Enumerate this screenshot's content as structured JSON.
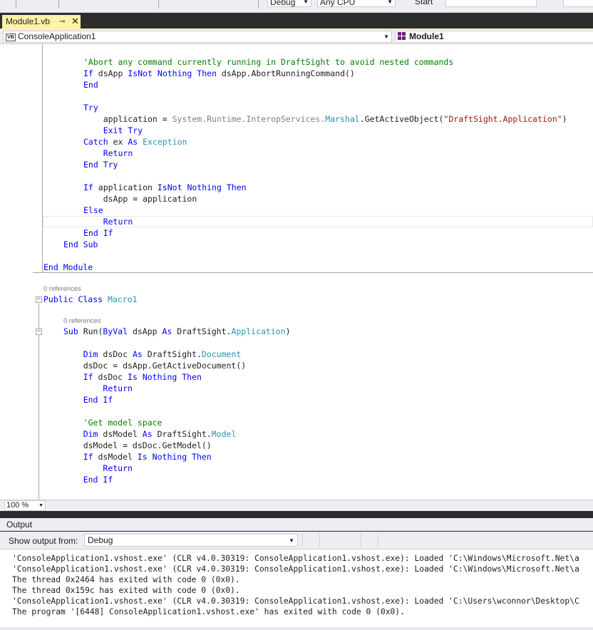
{
  "toolbar": {
    "config": "Debug",
    "platform": "Any CPU",
    "start_label": "Start"
  },
  "document_tab": {
    "label": "Module1.vb",
    "pin_glyph": "⊸",
    "close_glyph": "✕"
  },
  "navbar": {
    "project_icon": "VB",
    "project": "ConsoleApplication1",
    "member": "Module1"
  },
  "code_lines": [
    [
      {
        "t": "'Abort any command currently running in DraftSight to avoid nested commands",
        "c": "cm"
      }
    ],
    [
      {
        "t": "If",
        "c": "kw"
      },
      {
        "t": " dsApp "
      },
      {
        "t": "IsNot",
        "c": "kw"
      },
      {
        "t": " "
      },
      {
        "t": "Nothing",
        "c": "kw"
      },
      {
        "t": " "
      },
      {
        "t": "Then",
        "c": "kw"
      },
      {
        "t": " dsApp.AbortRunningCommand()"
      }
    ],
    [
      {
        "t": "End",
        "c": "kw"
      }
    ],
    [],
    [
      {
        "t": "Try",
        "c": "kw"
      }
    ],
    [
      {
        "t": "    application = "
      },
      {
        "t": "System.Runtime.InteropServices.",
        "c": "gr"
      },
      {
        "t": "Marshal",
        "c": "ty"
      },
      {
        "t": ".GetActiveObject("
      },
      {
        "t": "\"DraftSight.Application\"",
        "c": "st"
      },
      {
        "t": ")"
      }
    ],
    [
      {
        "t": "    "
      },
      {
        "t": "Exit Try",
        "c": "kw"
      }
    ],
    [
      {
        "t": "Catch",
        "c": "kw"
      },
      {
        "t": " ex "
      },
      {
        "t": "As",
        "c": "kw"
      },
      {
        "t": " "
      },
      {
        "t": "Exception",
        "c": "ty"
      }
    ],
    [
      {
        "t": "    "
      },
      {
        "t": "Return",
        "c": "kw"
      }
    ],
    [
      {
        "t": "End Try",
        "c": "kw"
      }
    ],
    [],
    [
      {
        "t": "If",
        "c": "kw"
      },
      {
        "t": " application "
      },
      {
        "t": "IsNot",
        "c": "kw"
      },
      {
        "t": " "
      },
      {
        "t": "Nothing",
        "c": "kw"
      },
      {
        "t": " "
      },
      {
        "t": "Then",
        "c": "kw"
      }
    ],
    [
      {
        "t": "    dsApp = application"
      }
    ],
    [
      {
        "t": "Else",
        "c": "kw"
      }
    ],
    [
      {
        "t": "    "
      },
      {
        "t": "Return",
        "c": "kw"
      }
    ],
    [
      {
        "t": "End If",
        "c": "kw"
      }
    ],
    [
      {
        "t": "End Sub",
        "c": "kw"
      }
    ],
    [],
    [
      {
        "t": "End Module",
        "c": "kw"
      }
    ]
  ],
  "class_block": {
    "ref1": "0 references",
    "class_decl": [
      {
        "t": "Public Class",
        "c": "kw"
      },
      {
        "t": " "
      },
      {
        "t": "Macro1",
        "c": "ty"
      }
    ],
    "ref2": "0 references",
    "lines": [
      [
        {
          "t": "Sub",
          "c": "kw"
        },
        {
          "t": " Run("
        },
        {
          "t": "ByVal",
          "c": "kw"
        },
        {
          "t": " dsApp "
        },
        {
          "t": "As",
          "c": "kw"
        },
        {
          "t": " DraftSight."
        },
        {
          "t": "Application",
          "c": "ty"
        },
        {
          "t": ")"
        }
      ],
      [],
      [
        {
          "t": "    "
        },
        {
          "t": "Dim",
          "c": "kw"
        },
        {
          "t": " dsDoc "
        },
        {
          "t": "As",
          "c": "kw"
        },
        {
          "t": " DraftSight."
        },
        {
          "t": "Document",
          "c": "ty"
        }
      ],
      [
        {
          "t": "    dsDoc = dsApp.GetActiveDocument()"
        }
      ],
      [
        {
          "t": "    "
        },
        {
          "t": "If",
          "c": "kw"
        },
        {
          "t": " dsDoc "
        },
        {
          "t": "Is",
          "c": "kw"
        },
        {
          "t": " "
        },
        {
          "t": "Nothing",
          "c": "kw"
        },
        {
          "t": " "
        },
        {
          "t": "Then",
          "c": "kw"
        }
      ],
      [
        {
          "t": "        "
        },
        {
          "t": "Return",
          "c": "kw"
        }
      ],
      [
        {
          "t": "    "
        },
        {
          "t": "End If",
          "c": "kw"
        }
      ],
      [],
      [
        {
          "t": "    "
        },
        {
          "t": "'Get model space",
          "c": "cm"
        }
      ],
      [
        {
          "t": "    "
        },
        {
          "t": "Dim",
          "c": "kw"
        },
        {
          "t": " dsModel "
        },
        {
          "t": "As",
          "c": "kw"
        },
        {
          "t": " DraftSight."
        },
        {
          "t": "Model",
          "c": "ty"
        }
      ],
      [
        {
          "t": "    dsModel = dsDoc.GetModel()"
        }
      ],
      [
        {
          "t": "    "
        },
        {
          "t": "If",
          "c": "kw"
        },
        {
          "t": " dsModel "
        },
        {
          "t": "Is",
          "c": "kw"
        },
        {
          "t": " "
        },
        {
          "t": "Nothing",
          "c": "kw"
        },
        {
          "t": " "
        },
        {
          "t": "Then",
          "c": "kw"
        }
      ],
      [
        {
          "t": "        "
        },
        {
          "t": "Return",
          "c": "kw"
        }
      ],
      [
        {
          "t": "    "
        },
        {
          "t": "End If",
          "c": "kw"
        }
      ]
    ]
  },
  "zoom": "100 %",
  "output": {
    "title": "Output",
    "show_from_label": "Show output from:",
    "source": "Debug",
    "lines": [
      "'ConsoleApplication1.vshost.exe' (CLR v4.0.30319: ConsoleApplication1.vshost.exe): Loaded 'C:\\Windows\\Microsoft.Net\\a",
      "'ConsoleApplication1.vshost.exe' (CLR v4.0.30319: ConsoleApplication1.vshost.exe): Loaded 'C:\\Windows\\Microsoft.Net\\a",
      "The thread 0x2464 has exited with code 0 (0x0).",
      "The thread 0x159c has exited with code 0 (0x0).",
      "'ConsoleApplication1.vshost.exe' (CLR v4.0.30319: ConsoleApplication1.vshost.exe): Loaded 'C:\\Users\\wconnor\\Desktop\\C",
      "The program '[6448] ConsoleApplication1.vshost.exe' has exited with code 0 (0x0)."
    ]
  },
  "colors": {
    "keyword": "#0000ff",
    "comment": "#008000",
    "type": "#2b91af",
    "string": "#a31515",
    "active_tab": "#fff1a8",
    "chrome_dark": "#2d2d30"
  }
}
